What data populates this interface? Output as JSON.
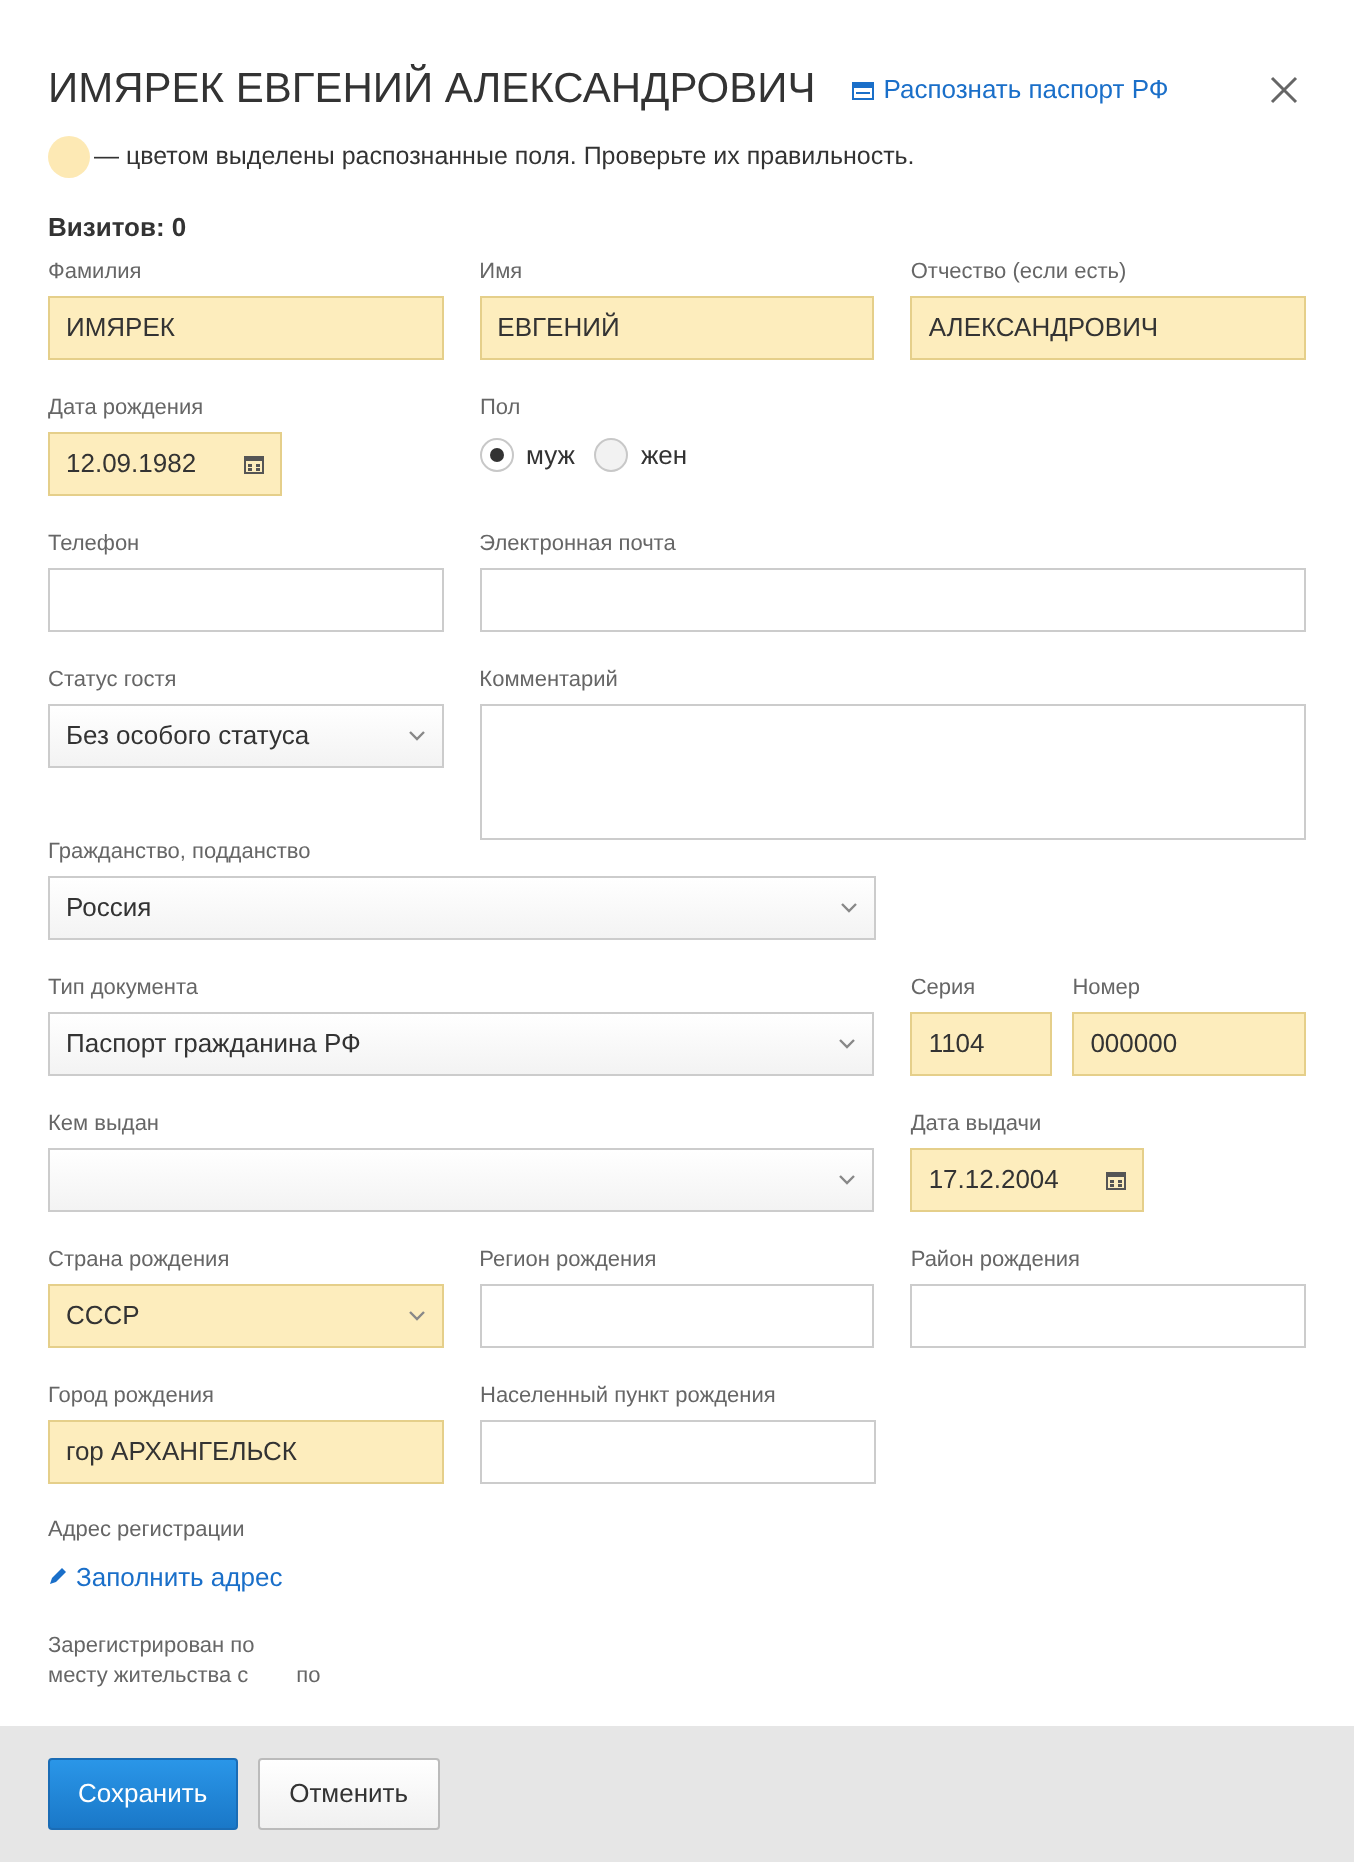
{
  "title": "ИМЯРЕК ЕВГЕНИЙ АЛЕКСАНДРОВИЧ",
  "recognize_link": "Распознать паспорт РФ",
  "legend": {
    "color": "#fde9b4",
    "text": "— цветом выделены распознанные поля. Проверьте их правильность."
  },
  "visits": "Визитов: 0",
  "rows": [
    [
      {
        "kind": "text",
        "label": "Фамилия",
        "value": "ИМЯРЕК",
        "highlighted": true
      },
      {
        "kind": "text",
        "label": "Имя",
        "value": "ЕВГЕНИЙ",
        "highlighted": true
      },
      {
        "kind": "text",
        "label": "Отчество (если есть)",
        "value": "АЛЕКСАНДРОВИЧ",
        "highlighted": true
      }
    ],
    [
      {
        "kind": "date",
        "label": "Дата рождения",
        "value": "12.09.1982",
        "highlighted": true
      },
      {
        "kind": "radio",
        "label": "Пол",
        "options": [
          {
            "label": "муж",
            "selected": true
          },
          {
            "label": "жен",
            "selected": false
          }
        ]
      }
    ],
    [
      {
        "kind": "text",
        "label": "Телефон",
        "highlighted": false
      },
      {
        "kind": "text",
        "label": "Электронная почта",
        "highlighted": false
      }
    ],
    [
      {
        "kind": "select",
        "label": "Статус гостя",
        "value": "Без особого статуса",
        "highlighted": false
      },
      {
        "kind": "textarea",
        "label": "Комментарий",
        "highlighted": false
      }
    ],
    [
      {
        "kind": "select",
        "label": "Гражданство, подданство",
        "value": "Россия",
        "highlighted": false
      }
    ],
    [
      {
        "kind": "select",
        "label": "Тип документа",
        "value": "Паспорт гражданина РФ",
        "highlighted": false
      },
      {
        "kind": "text",
        "label": "Серия",
        "value": "1104",
        "highlighted": true
      },
      {
        "kind": "text",
        "label": "Номер",
        "value": "000000",
        "highlighted": true
      }
    ],
    [
      {
        "kind": "select",
        "label": "Кем выдан",
        "highlighted": false
      },
      {
        "kind": "date",
        "label": "Дата выдачи",
        "value": "17.12.2004",
        "highlighted": true
      }
    ],
    [
      {
        "kind": "select",
        "label": "Страна рождения",
        "value": "СССР",
        "highlighted": true
      },
      {
        "kind": "text",
        "label": "Регион рождения",
        "highlighted": false
      },
      {
        "kind": "text",
        "label": "Район рождения",
        "highlighted": false
      }
    ],
    [
      {
        "kind": "text",
        "label": "Город рождения",
        "value": "гор АРХАНГЕЛЬСК",
        "highlighted": true
      },
      {
        "kind": "text",
        "label": "Населенный пункт рождения",
        "highlighted": false
      }
    ]
  ],
  "address": {
    "label": "Адрес регистрации",
    "link": "Заполнить адрес"
  },
  "registered_lines": [
    "Зарегистрирован по",
    "месту жительства с",
    "по"
  ],
  "buttons": {
    "save": "Сохранить",
    "cancel": "Отменить"
  }
}
